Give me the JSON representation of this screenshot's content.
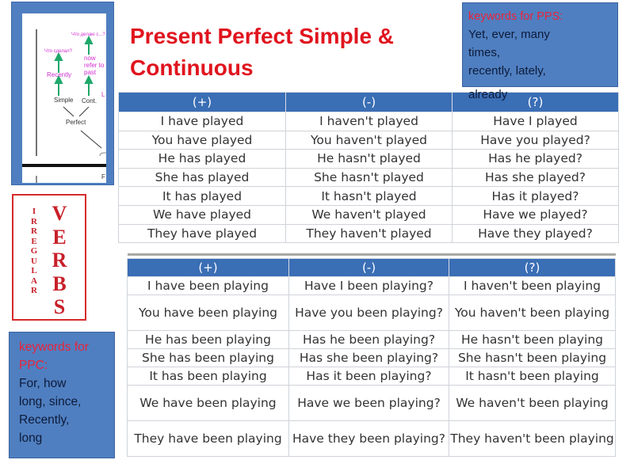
{
  "title": "Present Perfect Simple & Continuous",
  "diagram": {
    "labels": {
      "what_done": "Что сделал?",
      "what_doing": "Что делаю с...?",
      "recently": "Recently",
      "now_refer": [
        "now",
        "refer to",
        "past"
      ],
      "simple": "Simple",
      "cont": "Cont.",
      "perfect": "Perfect",
      "cut_l": "L",
      "cut_f": "F"
    }
  },
  "keywords_pps": {
    "heading": "keywords for PPS:",
    "lines": [
      "Yet, ever, many",
      "times,",
      "recently, lately,",
      "already"
    ]
  },
  "keywords_ppc": {
    "heading_lines": [
      "keywords for",
      "PPC:"
    ],
    "lines": [
      "For, how",
      "long, since,",
      "Recently,",
      "long"
    ]
  },
  "irregular_verbs": {
    "small": [
      "I",
      "R",
      "R",
      "E",
      "G",
      "U",
      "L",
      "A",
      "R"
    ],
    "big": [
      "V",
      "E",
      "R",
      "B",
      "S"
    ]
  },
  "table_simple": {
    "headers": [
      "(+)",
      "(-)",
      "(?)"
    ],
    "rows": [
      [
        "I have played",
        "I haven't played",
        "Have I played"
      ],
      [
        "You have played",
        "You haven't played",
        "Have you played?"
      ],
      [
        "He has played",
        "He hasn't played",
        "Has he played?"
      ],
      [
        "She has played",
        "She hasn't played",
        "Has she played?"
      ],
      [
        "It has played",
        "It hasn't played",
        "Has it played?"
      ],
      [
        "We have played",
        "We haven't played",
        "Have we played?"
      ],
      [
        "They have played",
        "They haven't played",
        "Have they played?"
      ]
    ]
  },
  "table_continuous": {
    "headers": [
      "(+)",
      "(-)",
      "(?)"
    ],
    "rows": [
      [
        "I have been playing",
        "Have I been playing?",
        "I haven't been playing"
      ],
      [
        "You have been playing",
        "Have you been playing?",
        "You haven't been playing"
      ],
      [
        "He has been playing",
        "Has he been playing?",
        "He hasn't been playing"
      ],
      [
        "She has been playing",
        "Has she been playing?",
        "She hasn't been playing"
      ],
      [
        "It has been playing",
        "Has it been playing?",
        "It hasn't been playing"
      ],
      [
        "We have been playing",
        "Have we been playing?",
        "We haven't been playing"
      ],
      [
        "They have been playing",
        "Have they been playing?",
        "They haven't been playing"
      ]
    ]
  },
  "colors": {
    "title_red": "#e0141e",
    "box_blue": "#4f7fc0",
    "header_blue": "#3a6eb5",
    "keyword_red": "#e8243c",
    "diagram_pink": "#d02fd0",
    "arrow_green": "#1fa86a"
  }
}
